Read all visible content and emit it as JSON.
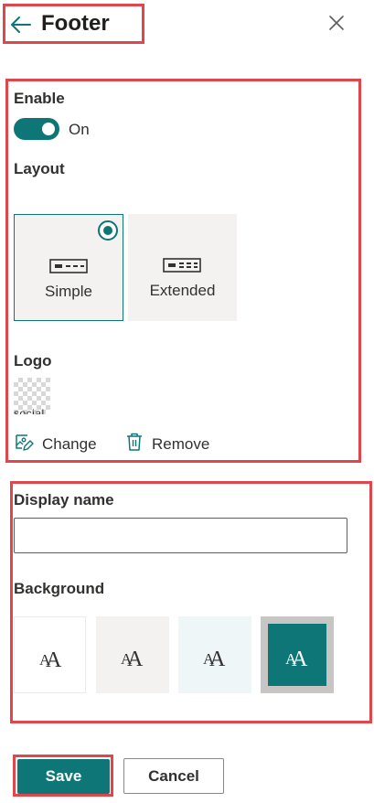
{
  "header": {
    "title": "Footer",
    "back_icon": "arrow-left-icon",
    "close_icon": "close-icon"
  },
  "enable": {
    "label": "Enable",
    "toggle_state": "On",
    "toggle_on": true
  },
  "layout": {
    "label": "Layout",
    "options": [
      {
        "label": "Simple",
        "selected": true,
        "icon": "simple-layout-icon"
      },
      {
        "label": "Extended",
        "selected": false,
        "icon": "extended-layout-icon"
      }
    ]
  },
  "logo": {
    "label": "Logo",
    "thumbnail_text": "social",
    "change_label": "Change",
    "remove_label": "Remove",
    "change_icon": "edit-image-icon",
    "remove_icon": "trash-icon"
  },
  "display_name": {
    "label": "Display name",
    "value": "",
    "placeholder": ""
  },
  "background": {
    "label": "Background",
    "swatch_glyph": "AA",
    "options": [
      {
        "name": "white",
        "color": "#ffffff",
        "selected": false
      },
      {
        "name": "neutral",
        "color": "#f3f2f1",
        "selected": false
      },
      {
        "name": "soft",
        "color": "#eef6f8",
        "selected": false
      },
      {
        "name": "strong",
        "color": "#0e7677",
        "selected": true
      }
    ]
  },
  "buttons": {
    "save": "Save",
    "cancel": "Cancel"
  },
  "colors": {
    "accent": "#0e7677",
    "annotation_red": "#e0474c",
    "tile_gray": "#f3f2f1"
  }
}
